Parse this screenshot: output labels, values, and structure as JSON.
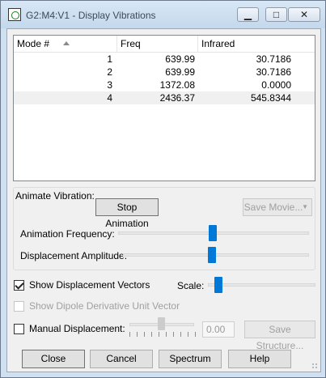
{
  "window": {
    "title": "G2:M4:V1 - Display Vibrations",
    "minimize": "▁",
    "maximize": "□",
    "close": "✕"
  },
  "table": {
    "columns": [
      "Mode #",
      "Freq",
      "Infrared"
    ],
    "rows": [
      {
        "mode": "1",
        "freq": "639.99",
        "infrared": "30.7186"
      },
      {
        "mode": "2",
        "freq": "639.99",
        "infrared": "30.7186"
      },
      {
        "mode": "3",
        "freq": "1372.08",
        "infrared": "0.0000"
      },
      {
        "mode": "4",
        "freq": "2436.37",
        "infrared": "545.8344"
      }
    ],
    "selected_row": 4
  },
  "animate": {
    "group_label": "Animate Vibration:",
    "stop_button": "Stop Animation",
    "save_movie_button": "Save Movie...",
    "frequency_label": "Animation Frequency:",
    "frequency_level": 0.5,
    "amplitude_label": "Displacement Amplitude:",
    "amplitude_level": 0.5
  },
  "options": {
    "show_vectors_label": "Show Displacement Vectors",
    "show_vectors_checked": true,
    "scale_label": "Scale:",
    "scale_level": 0.07,
    "dipole_label": "Show Dipole Derivative Unit Vector",
    "dipole_checked": false,
    "manual_label": "Manual Displacement:",
    "manual_checked": false,
    "manual_value": "0.00",
    "save_structure_button": "Save Structure..."
  },
  "footer": {
    "close": "Close",
    "cancel": "Cancel",
    "spectrum": "Spectrum",
    "help": "Help"
  },
  "icons": [
    "app-icon",
    "sort-ascending-icon",
    "dropdown-arrow-icon",
    "resize-grip-icon"
  ]
}
